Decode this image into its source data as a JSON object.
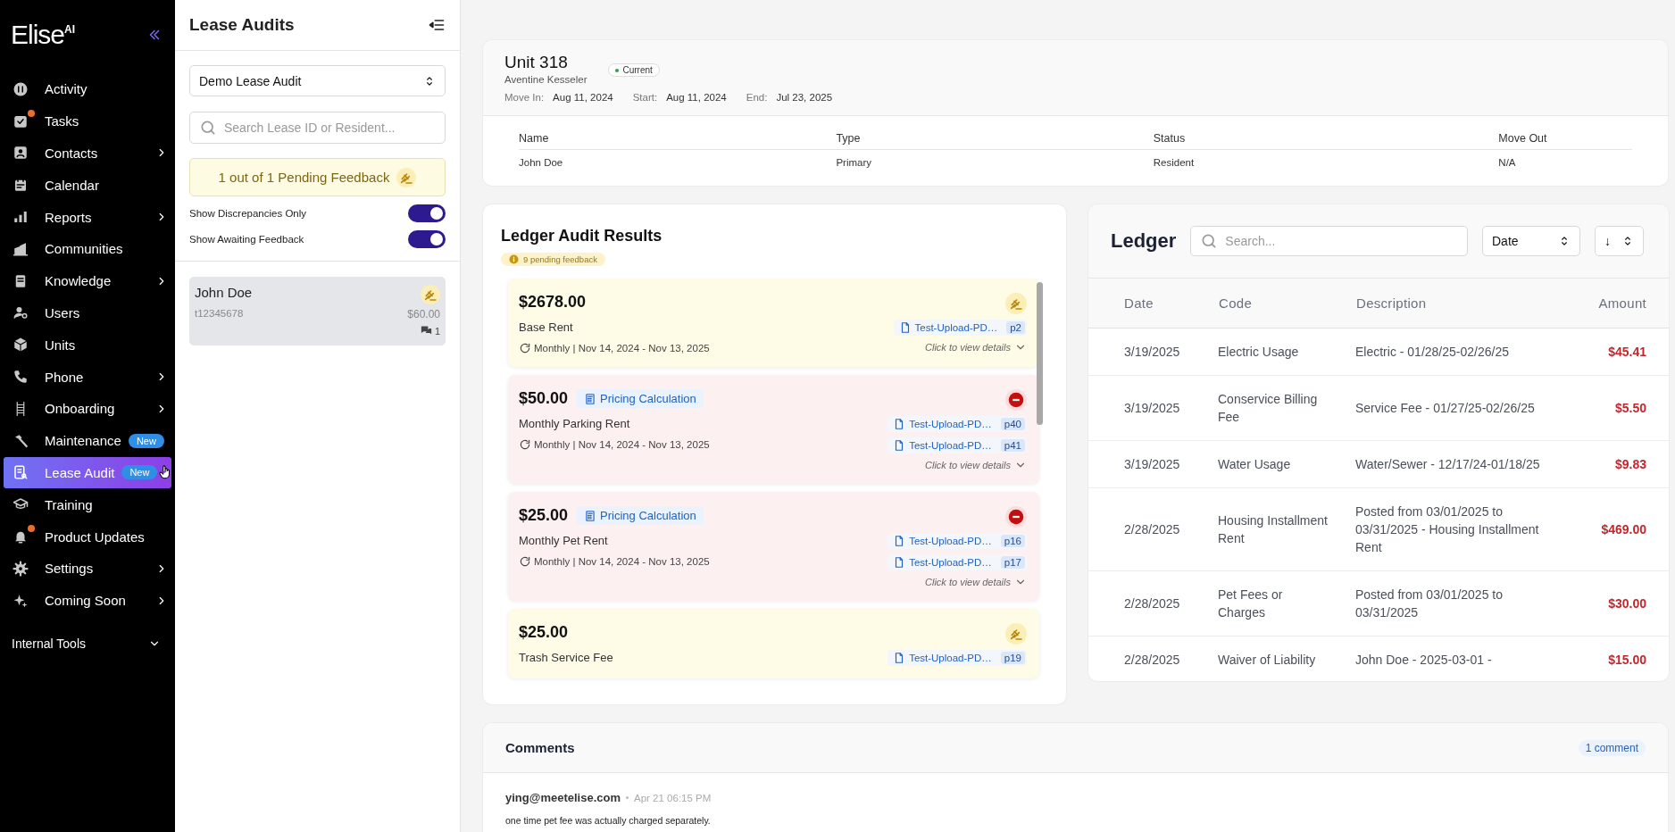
{
  "sidebar": {
    "logo": {
      "name": "Elise",
      "suffix": "AI"
    },
    "items": [
      {
        "label": "Activity",
        "submenu": false,
        "notify": false,
        "selected": false
      },
      {
        "label": "Tasks",
        "submenu": false,
        "notify": true,
        "selected": false
      },
      {
        "label": "Contacts",
        "submenu": true,
        "notify": false,
        "selected": false
      },
      {
        "label": "Calendar",
        "submenu": false,
        "notify": false,
        "selected": false
      },
      {
        "label": "Reports",
        "submenu": true,
        "notify": false,
        "selected": false
      },
      {
        "label": "Communities",
        "submenu": false,
        "notify": false,
        "selected": false
      },
      {
        "label": "Knowledge",
        "submenu": true,
        "notify": false,
        "selected": false
      },
      {
        "label": "Users",
        "submenu": false,
        "notify": false,
        "selected": false
      },
      {
        "label": "Units",
        "submenu": false,
        "notify": false,
        "selected": false
      },
      {
        "label": "Phone",
        "submenu": true,
        "notify": false,
        "selected": false
      },
      {
        "label": "Onboarding",
        "submenu": true,
        "notify": false,
        "selected": false
      },
      {
        "label": "Maintenance",
        "submenu": false,
        "notify": false,
        "selected": false,
        "badge": "New"
      },
      {
        "label": "Lease Audit",
        "submenu": false,
        "notify": false,
        "selected": true,
        "badge": "New"
      },
      {
        "label": "Training",
        "submenu": false,
        "notify": false,
        "selected": false
      },
      {
        "label": "Product Updates",
        "submenu": false,
        "notify": true,
        "selected": false
      },
      {
        "label": "Settings",
        "submenu": true,
        "notify": false,
        "selected": false
      },
      {
        "label": "Coming Soon",
        "submenu": true,
        "notify": false,
        "selected": false
      }
    ],
    "section": {
      "label": "Internal Tools"
    }
  },
  "audits_panel": {
    "title": "Lease Audits",
    "audit_select": {
      "value": "Demo Lease Audit"
    },
    "search": {
      "placeholder": "Search Lease ID or Resident..."
    },
    "banner": "1 out of 1 Pending Feedback",
    "toggles": [
      {
        "label": "Show Discrepancies Only",
        "on": true
      },
      {
        "label": "Show Awaiting Feedback",
        "on": true
      }
    ],
    "residents": [
      {
        "name": "John Doe",
        "lease_id": "t12345678",
        "amount": "$60.00",
        "comments": "1",
        "selected": true
      }
    ]
  },
  "unit": {
    "title": "Unit 318",
    "subtitle": "Aventine Kesseler",
    "status": "Current",
    "dates": [
      {
        "label": "Move In:",
        "value": "Aug 11, 2024"
      },
      {
        "label": "Start:",
        "value": "Aug 11, 2024"
      },
      {
        "label": "End:",
        "value": "Jul 23, 2025"
      }
    ],
    "table": {
      "columns": [
        "Name",
        "Type",
        "Status",
        "Move Out"
      ],
      "rows": [
        [
          "John Doe",
          "Primary",
          "Resident",
          "N/A"
        ]
      ]
    }
  },
  "audit_results": {
    "title": "Ledger Audit Results",
    "pending": "9 pending feedback",
    "items": [
      {
        "kind": "pending",
        "amount": "$2678.00",
        "name": "Base Rent",
        "schedule": "Monthly | Nov 14, 2024 - Nov 13, 2025",
        "docs": [
          {
            "file": "Test-Upload-PD…",
            "page": "p2"
          }
        ],
        "details": "Click to view details"
      },
      {
        "kind": "discrepancy",
        "amount": "$50.00",
        "tag": "Pricing Calculation",
        "name": "Monthly Parking Rent",
        "schedule": "Monthly | Nov 14, 2024 - Nov 13, 2025",
        "docs": [
          {
            "file": "Test-Upload-PD…",
            "page": "p40"
          },
          {
            "file": "Test-Upload-PD…",
            "page": "p41"
          }
        ],
        "details": "Click to view details"
      },
      {
        "kind": "discrepancy",
        "amount": "$25.00",
        "tag": "Pricing Calculation",
        "name": "Monthly Pet Rent",
        "schedule": "Monthly | Nov 14, 2024 - Nov 13, 2025",
        "docs": [
          {
            "file": "Test-Upload-PD…",
            "page": "p16"
          },
          {
            "file": "Test-Upload-PD…",
            "page": "p17"
          }
        ],
        "details": "Click to view details"
      },
      {
        "kind": "pending",
        "amount": "$25.00",
        "name": "Trash Service Fee",
        "docs": [
          {
            "file": "Test-Upload-PD…",
            "page": "p19"
          }
        ]
      }
    ]
  },
  "ledger": {
    "title": "Ledger",
    "search": {
      "placeholder": "Search..."
    },
    "sort": {
      "value": "Date"
    },
    "direction": "↓",
    "columns": [
      "Date",
      "Code",
      "Description",
      "Amount"
    ],
    "rows": [
      [
        "3/19/2025",
        "Electric Usage",
        "Electric - 01/28/25-02/26/25",
        "$45.41"
      ],
      [
        "3/19/2025",
        "Conservice Billing Fee",
        "Service Fee - 01/27/25-02/26/25",
        "$5.50"
      ],
      [
        "3/19/2025",
        "Water Usage",
        "Water/Sewer - 12/17/24-01/18/25",
        "$9.83"
      ],
      [
        "2/28/2025",
        "Housing Installment Rent",
        "Posted from 03/01/2025 to 03/31/2025 - Housing Installment Rent",
        "$469.00"
      ],
      [
        "2/28/2025",
        "Pet Fees or Charges",
        "Posted from 03/01/2025 to 03/31/2025",
        "$30.00"
      ],
      [
        "2/28/2025",
        "Waiver of Liability",
        "John Doe - 2025-03-01 -",
        "$15.00"
      ]
    ]
  },
  "comments": {
    "title": "Comments",
    "count": "1 comment",
    "entries": [
      {
        "author": "ying@meetelise.com",
        "time": "Apr 21 06:15 PM",
        "text": "one time pet fee was actually charged separately."
      }
    ]
  }
}
